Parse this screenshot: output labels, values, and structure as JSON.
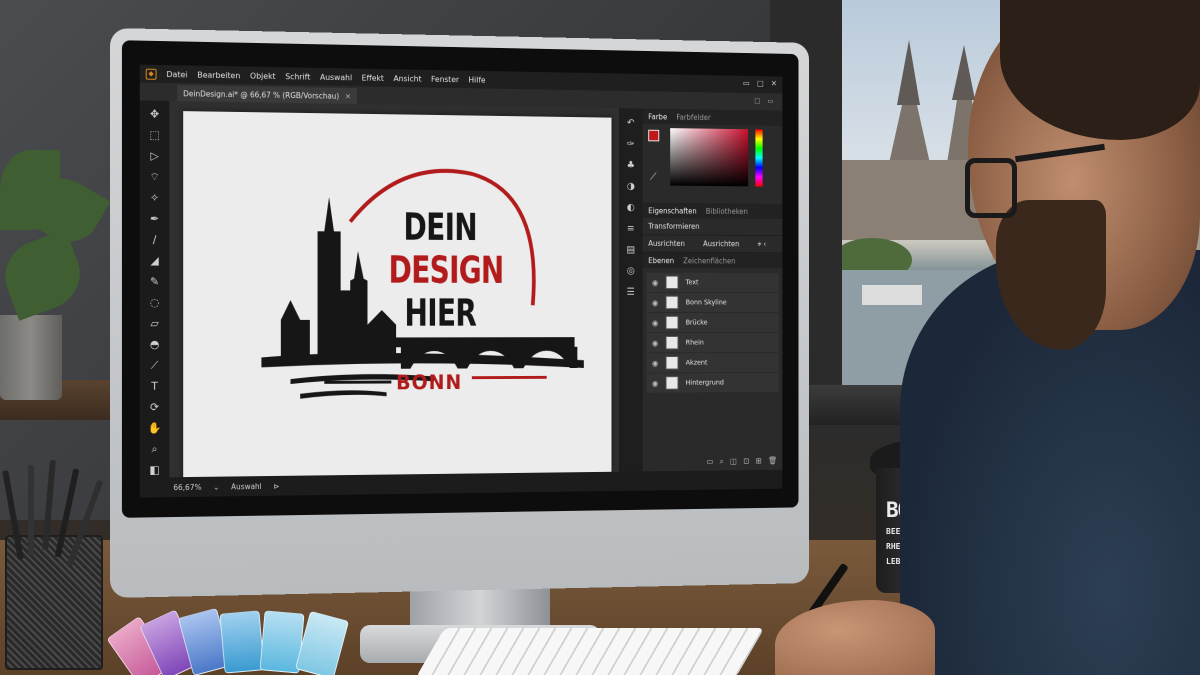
{
  "app": {
    "menu": [
      "Datei",
      "Bearbeiten",
      "Objekt",
      "Schrift",
      "Auswahl",
      "Effekt",
      "Ansicht",
      "Fenster",
      "Hilfe"
    ],
    "window_controls": [
      "▭",
      "□",
      "✕"
    ]
  },
  "document": {
    "tab_title": "DeinDesign.ai* @ 66,67 % (RGB/Vorschau)",
    "tab_close": "✕"
  },
  "tabrow_controls": [
    "□",
    "▭"
  ],
  "status": {
    "zoom": "66,67%",
    "mode": "Auswahl"
  },
  "artwork": {
    "line1": "DEIN",
    "line2": "DESIGN",
    "line3": "HIER",
    "city": "BONN",
    "colors": {
      "accent": "#b21b1b",
      "ink": "#161616"
    }
  },
  "panels": {
    "color_tabs": [
      "Farbe",
      "Farbfelder"
    ],
    "properties_tabs": [
      "Eigenschaften",
      "Bibliotheken"
    ],
    "transform_label": "Transformieren",
    "align_label": "Ausrichten",
    "align_dropdown": "Ausrichten",
    "layers_tabs": [
      "Ebenen",
      "Zeichenflächen"
    ],
    "layers": [
      {
        "name": "Text"
      },
      {
        "name": "Bonn Skyline"
      },
      {
        "name": "Brücke"
      },
      {
        "name": "Rhein"
      },
      {
        "name": "Akzent"
      },
      {
        "name": "Hintergrund"
      }
    ]
  },
  "coffee_cup": {
    "title": "BONN.",
    "line1": "BEETHOVEN.",
    "line2": "RHEIN.",
    "line3": "LEBENSFREUDE."
  }
}
